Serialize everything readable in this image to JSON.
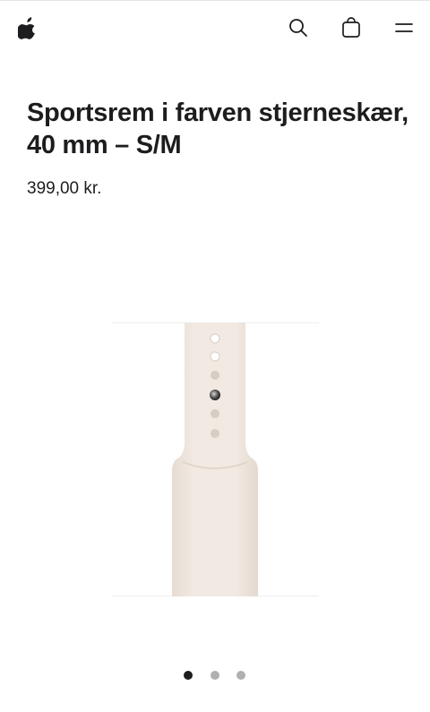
{
  "nav": {
    "icons": [
      "apple-logo-icon",
      "search-icon",
      "shopping-bag-icon",
      "menu-icon"
    ]
  },
  "product": {
    "title_line1": "Sportsrem i farven stjerneskær,",
    "title_line2": "40 mm – S/M",
    "price": "399,00 kr.",
    "band_color": "#ede4dc"
  },
  "gallery": {
    "slide_count": 3,
    "active_index": 1
  }
}
